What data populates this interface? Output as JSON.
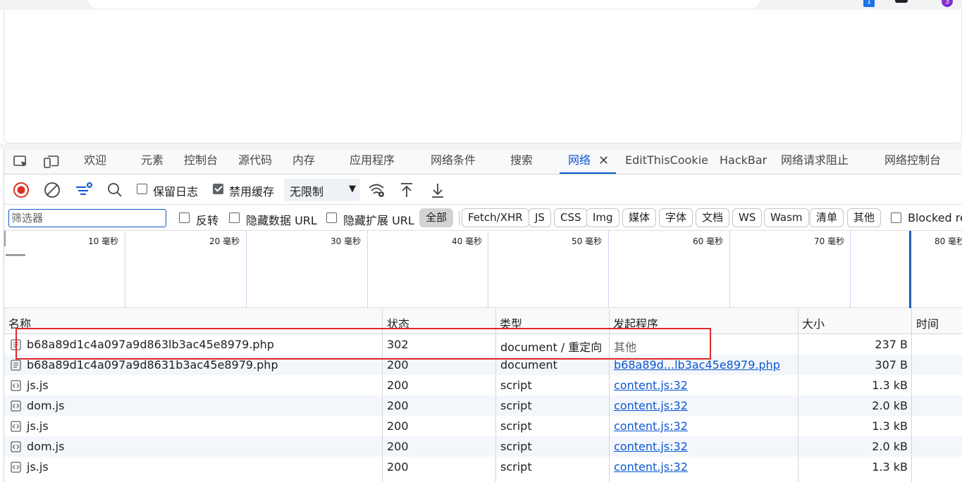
{
  "browser": {
    "tab_count_badge": "1",
    "profile_badge": "3"
  },
  "devtools": {
    "tabs": [
      {
        "label": "欢迎",
        "name": "welcome"
      },
      {
        "label": "元素",
        "name": "elements"
      },
      {
        "label": "控制台",
        "name": "console"
      },
      {
        "label": "源代码",
        "name": "sources"
      },
      {
        "label": "内存",
        "name": "memory"
      },
      {
        "label": "应用程序",
        "name": "application"
      },
      {
        "label": "网络条件",
        "name": "network-conditions"
      },
      {
        "label": "搜索",
        "name": "search"
      },
      {
        "label": "网络",
        "name": "network"
      },
      {
        "label": "EditThisCookie",
        "name": "editthiscookie"
      },
      {
        "label": "HackBar",
        "name": "hackbar"
      },
      {
        "label": "网络请求阻止",
        "name": "network-request-blocking"
      },
      {
        "label": "网络控制台",
        "name": "network-console"
      }
    ],
    "active_tab": "网络"
  },
  "toolbar": {
    "preserve_log_label": "保留日志",
    "preserve_log_checked": false,
    "disable_cache_label": "禁用缓存",
    "disable_cache_checked": true,
    "throttle_value": "无限制"
  },
  "filter": {
    "placeholder": "筛选器",
    "invert_label": "反转",
    "hide_data_url_label": "隐藏数据 URL",
    "hide_extension_url_label": "隐藏扩展 URL",
    "types": [
      "全部",
      "Fetch/XHR",
      "JS",
      "CSS",
      "Img",
      "媒体",
      "字体",
      "文档",
      "WS",
      "Wasm",
      "清单",
      "其他"
    ],
    "selected_type": "全部",
    "blocked_label": "Blocked re"
  },
  "overview": {
    "ticks": [
      {
        "value": "10",
        "unit": "毫秒"
      },
      {
        "value": "20",
        "unit": "毫秒"
      },
      {
        "value": "30",
        "unit": "毫秒"
      },
      {
        "value": "40",
        "unit": "毫秒"
      },
      {
        "value": "50",
        "unit": "毫秒"
      },
      {
        "value": "60",
        "unit": "毫秒"
      },
      {
        "value": "70",
        "unit": "毫秒"
      },
      {
        "value": "80",
        "unit": "毫秒"
      }
    ]
  },
  "table": {
    "headers": {
      "name": "名称",
      "status": "状态",
      "type": "类型",
      "initiator": "发起程序",
      "size": "大小",
      "time": "时间"
    },
    "rows": [
      {
        "name": "b68a89d1c4a097a9d863lb3ac45e8979.php",
        "status": "302",
        "type": "document / 重定向",
        "initiator": "其他",
        "initiator_link": false,
        "size": "237 B",
        "icon": "document-icon"
      },
      {
        "name": "b68a89d1c4a097a9d8631b3ac45e8979.php",
        "status": "200",
        "type": "document",
        "initiator": "b68a89d...lb3ac45e8979.php",
        "initiator_link": true,
        "size": "307 B",
        "icon": "document-icon"
      },
      {
        "name": "js.js",
        "status": "200",
        "type": "script",
        "initiator": "content.js:32",
        "initiator_link": true,
        "size": "1.3 kB",
        "icon": "script-icon"
      },
      {
        "name": "dom.js",
        "status": "200",
        "type": "script",
        "initiator": "content.js:32",
        "initiator_link": true,
        "size": "2.0 kB",
        "icon": "script-icon"
      },
      {
        "name": "js.js",
        "status": "200",
        "type": "script",
        "initiator": "content.js:32",
        "initiator_link": true,
        "size": "1.3 kB",
        "icon": "script-icon"
      },
      {
        "name": "dom.js",
        "status": "200",
        "type": "script",
        "initiator": "content.js:32",
        "initiator_link": true,
        "size": "2.0 kB",
        "icon": "script-icon"
      },
      {
        "name": "js.js",
        "status": "200",
        "type": "script",
        "initiator": "content.js:32",
        "initiator_link": true,
        "size": "1.3 kB",
        "icon": "script-icon"
      }
    ]
  },
  "colors": {
    "accent": "#0b57d0",
    "record": "#d93025",
    "highlight": "#e0292b",
    "row_alt": "#f3f6fb"
  }
}
